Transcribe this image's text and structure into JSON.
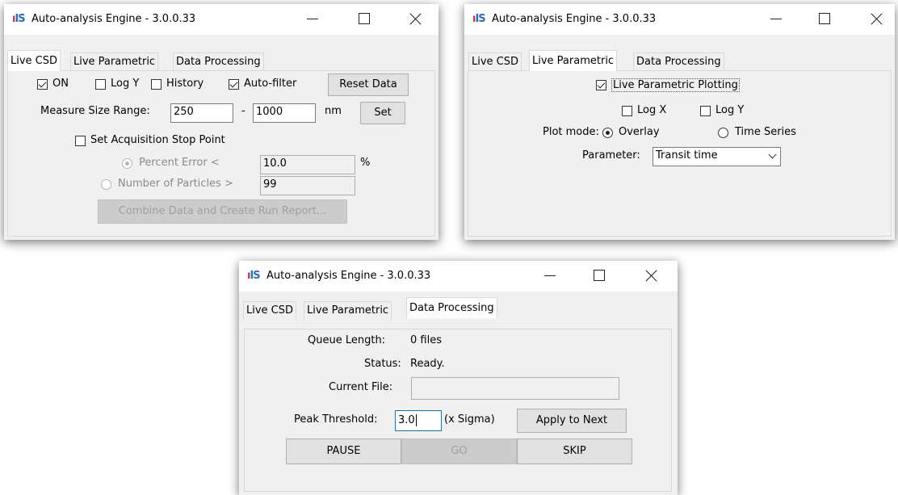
{
  "app": {
    "title": "Auto-analysis Engine - 3.0.0.33",
    "logo_text": "IS",
    "tabs": [
      "Live CSD",
      "Live Parametric",
      "Data Processing"
    ]
  },
  "live_csd": {
    "on_label": "ON",
    "on_checked": true,
    "logy_label": "Log Y",
    "logy_checked": false,
    "history_label": "History",
    "history_checked": false,
    "autofilter_label": "Auto-filter",
    "autofilter_checked": true,
    "reset_label": "Reset Data",
    "measure_label": "Measure Size Range:",
    "range_min": "250",
    "range_sep": "-",
    "range_max": "1000",
    "range_unit": "nm",
    "set_label": "Set",
    "stop_label": "Set Acquisition Stop Point",
    "stop_checked": false,
    "percent_label": "Percent Error <",
    "percent_value": "10.0",
    "percent_unit": "%",
    "particles_label": "Number of Particles >",
    "particles_value": "99",
    "combine_label": "Combine Data and Create Run Report..."
  },
  "live_param": {
    "plotting_label": "Live Parametric Plotting",
    "plotting_checked": true,
    "logx_label": "Log X",
    "logy_label": "Log Y",
    "plotmode_label": "Plot mode:",
    "overlay_label": "Overlay",
    "timeseries_label": "Time Series",
    "selected_mode": "Overlay",
    "parameter_label": "Parameter:",
    "parameter_value": "Transit time"
  },
  "data_proc": {
    "queue_label": "Queue Length:",
    "queue_value": "0 files",
    "status_label": "Status:",
    "status_value": "Ready.",
    "file_label": "Current File:",
    "file_value": "",
    "threshold_label": "Peak Threshold:",
    "threshold_value": "3.0",
    "sigma_label": "(x Sigma)",
    "apply_label": "Apply to Next",
    "pause_label": "PAUSE",
    "go_label": "GO",
    "skip_label": "SKIP"
  },
  "colors": {
    "accent": "#0078d7",
    "window": "#f0f0f0",
    "logo_blue": "#2b6cc4",
    "logo_red": "#cc3333"
  }
}
